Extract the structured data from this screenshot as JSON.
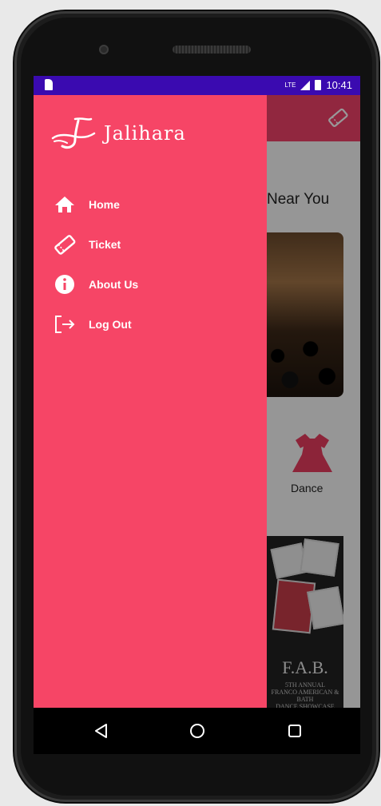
{
  "status_bar": {
    "network": "LTE",
    "time": "10:41"
  },
  "app_behind": {
    "heading": "Near You",
    "category": "Dance",
    "poster_title": "F.A.B.",
    "poster_subtitle": "5TH ANNUAL\nFRANCO AMERICAN & BATH\nDANCE SHOWCASE"
  },
  "drawer": {
    "brand": "Jalihara",
    "items": [
      {
        "label": "Home",
        "icon": "home-icon"
      },
      {
        "label": "Ticket",
        "icon": "ticket-icon"
      },
      {
        "label": "About Us",
        "icon": "info-icon"
      },
      {
        "label": "Log Out",
        "icon": "logout-icon"
      }
    ]
  },
  "colors": {
    "drawer": "#f64566",
    "status_bar": "#3a0ab0",
    "accent": "#e93d60"
  }
}
